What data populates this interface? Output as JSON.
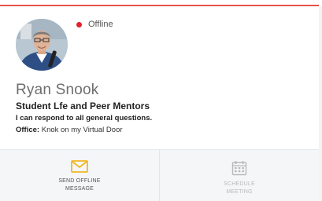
{
  "profile": {
    "status": "Offline",
    "name": "Ryan Snook",
    "department": "Student Lfe and Peer Mentors",
    "description": "I can respond to all general questions.",
    "office_label": "Office:",
    "office_value": "Knok on my Virtual Door"
  },
  "actions": {
    "send_message_line1": "SEND OFFLINE",
    "send_message_line2": "MESSAGE",
    "schedule_line1": "SCHEDULE",
    "schedule_line2": "MEETING"
  },
  "colors": {
    "accent_border": "#e8514a",
    "status_offline": "#e2222c",
    "mail_icon": "#f2b722",
    "disabled": "#b9b9b9"
  },
  "icons": {
    "status": "status-dot-icon",
    "message": "envelope-icon",
    "schedule": "calendar-icon"
  }
}
